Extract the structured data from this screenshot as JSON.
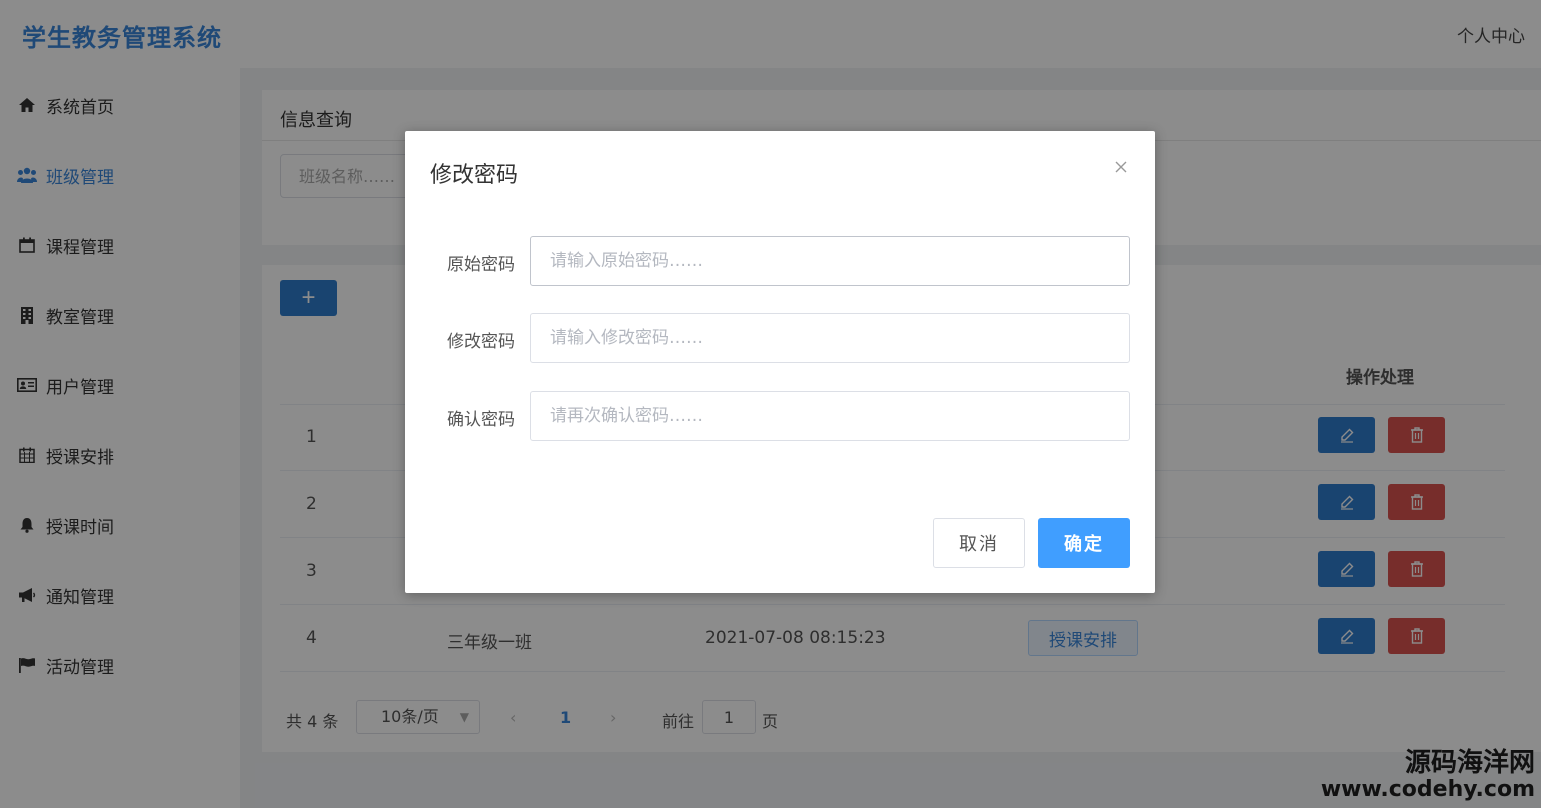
{
  "header": {
    "app_title": "学生教务管理系统",
    "user_center": "个人中心"
  },
  "sidebar": {
    "items": [
      {
        "label": "系统首页",
        "icon": "home-icon"
      },
      {
        "label": "班级管理",
        "icon": "users-icon"
      },
      {
        "label": "课程管理",
        "icon": "calendar-icon"
      },
      {
        "label": "教室管理",
        "icon": "building-icon"
      },
      {
        "label": "用户管理",
        "icon": "id-card-icon"
      },
      {
        "label": "授课安排",
        "icon": "calendar-grid-icon"
      },
      {
        "label": "授课时间",
        "icon": "bell-icon"
      },
      {
        "label": "通知管理",
        "icon": "bullhorn-icon"
      },
      {
        "label": "活动管理",
        "icon": "flag-icon"
      }
    ],
    "active_index": 1,
    "accent_color": "#3a86d9"
  },
  "search_panel": {
    "title": "信息查询",
    "class_name_placeholder": "班级名称……"
  },
  "table": {
    "add_label": "+",
    "ops_header": "操作处理",
    "rows": [
      {
        "index": "1"
      },
      {
        "index": "2"
      },
      {
        "index": "3"
      },
      {
        "index": "4",
        "name": "三年级一班",
        "time": "2021-07-08 08:15:23",
        "schedule_label": "授课安排"
      }
    ]
  },
  "pagination": {
    "total": "共 4 条",
    "page_size": "10条/页",
    "prev": "‹",
    "current": "1",
    "next": "›",
    "goto_label": "前往",
    "goto_value": "1",
    "page_suffix": "页"
  },
  "dialog": {
    "title": "修改密码",
    "fields": [
      {
        "label": "原始密码",
        "placeholder": "请输入原始密码……"
      },
      {
        "label": "修改密码",
        "placeholder": "请输入修改密码……"
      },
      {
        "label": "确认密码",
        "placeholder": "请再次确认密码……"
      }
    ],
    "cancel_label": "取消",
    "confirm_label": "确定",
    "confirm_color": "#409eff"
  },
  "watermark": {
    "name": "源码海洋网",
    "url": "www.codehy.com"
  }
}
